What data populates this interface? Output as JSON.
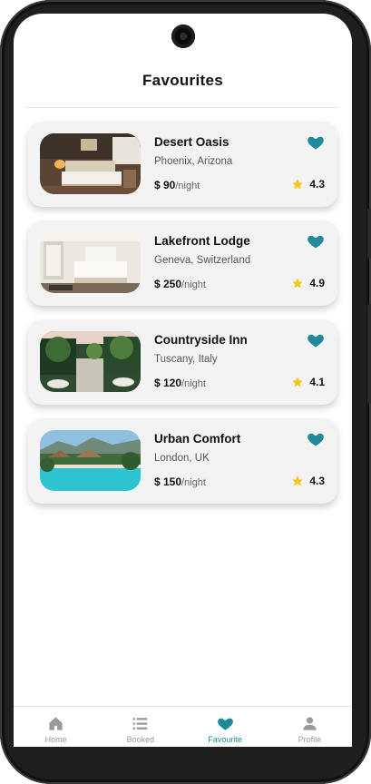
{
  "header": {
    "title": "Favourites"
  },
  "colors": {
    "accent": "#1f8a99",
    "star": "#f5c518",
    "inactive": "#9a9a9a"
  },
  "favourites": [
    {
      "name": "Desert Oasis",
      "location": "Phoenix, Arizona",
      "price": "$ 90",
      "per": "/night",
      "rating": "4.3",
      "favorited": true
    },
    {
      "name": "Lakefront Lodge",
      "location": "Geneva, Switzerland",
      "price": "$ 250",
      "per": "/night",
      "rating": "4.9",
      "favorited": true
    },
    {
      "name": "Countryside Inn",
      "location": "Tuscany, Italy",
      "price": "$ 120",
      "per": "/night",
      "rating": "4.1",
      "favorited": true
    },
    {
      "name": "Urban Comfort",
      "location": "London, UK",
      "price": "$ 150",
      "per": "/night",
      "rating": "4.3",
      "favorited": true
    }
  ],
  "nav": {
    "items": [
      {
        "label": "Home",
        "icon": "home-icon",
        "active": false
      },
      {
        "label": "Booked",
        "icon": "list-icon",
        "active": false
      },
      {
        "label": "Favourite",
        "icon": "heart-icon",
        "active": true
      },
      {
        "label": "Profile",
        "icon": "person-icon",
        "active": false
      }
    ]
  }
}
